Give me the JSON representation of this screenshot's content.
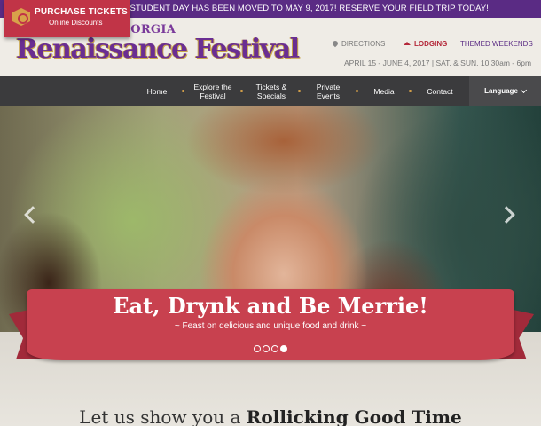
{
  "announcement": "TEACHERS – OUR STUDENT DAY HAS BEEN MOVED TO MAY 9, 2017! RESERVE YOUR FIELD TRIP TODAY!",
  "logo": {
    "the": "THE GEORGIA",
    "main": "Renaissance Festival"
  },
  "toplinks": {
    "directions": "DIRECTIONS",
    "lodging": "LODGING",
    "themed": "THEMED WEEKENDS"
  },
  "dates": "APRIL 15 - JUNE 4, 2017 | SAT. & SUN. 10:30am - 6pm",
  "buy": {
    "title": "PURCHASE TICKETS",
    "subtitle": "Online Discounts"
  },
  "nav": {
    "home": "Home",
    "explore": "Explore the Festival",
    "tickets": "Tickets & Specials",
    "private": "Private Events",
    "media": "Media",
    "contact": "Contact",
    "language": "Language"
  },
  "hero": {
    "title": "Eat, Drynk and Be Merrie!",
    "subtitle": "~ Feast on delicious and unique food and drink ~",
    "slides": 4,
    "active_slide": 4
  },
  "tagline": {
    "pre": "Let us show you a ",
    "bold": "Rollicking Good Time"
  },
  "colors": {
    "purple": "#5a2b84",
    "red": "#c13447",
    "nav": "#3b3b3d",
    "gold": "#d8a24a"
  }
}
